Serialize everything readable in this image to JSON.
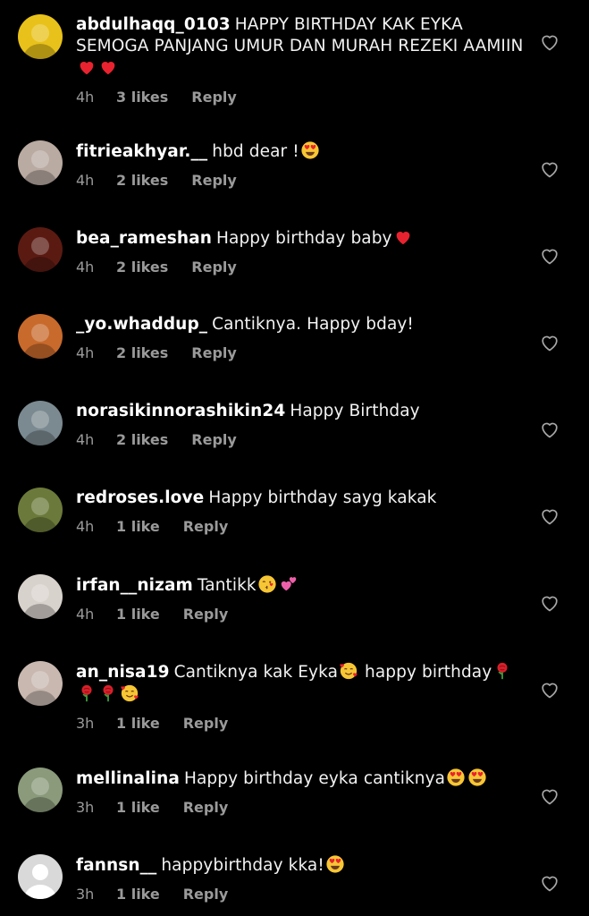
{
  "comments": [
    {
      "username": "abdulhaqq_0103",
      "text": "HAPPY BIRTHDAY KAK EYKA SEMOGA PANJANG UMUR DAN MURAH REZEKI AAMIIN",
      "emojis": [
        "heart-red",
        "heart-red"
      ],
      "time": "4h",
      "likes": "3 likes",
      "reply": "Reply",
      "avatar_color": "#e8c21a"
    },
    {
      "username": "fitrieakhyar.__",
      "text": "hbd dear !",
      "emojis": [
        "heart-eyes"
      ],
      "time": "4h",
      "likes": "2 likes",
      "reply": "Reply",
      "avatar_color": "#b9aaa2"
    },
    {
      "username": "bea_rameshan",
      "text": "Happy birthday baby",
      "emojis": [
        "heart-red"
      ],
      "time": "4h",
      "likes": "2 likes",
      "reply": "Reply",
      "avatar_color": "#5a1a12"
    },
    {
      "username": "_yo.whaddup_",
      "text": "Cantiknya. Happy bday!",
      "emojis": [],
      "time": "4h",
      "likes": "2 likes",
      "reply": "Reply",
      "avatar_color": "#c86a2c"
    },
    {
      "username": "norasikinnorashikin24",
      "text": "Happy Birthday",
      "emojis": [],
      "time": "4h",
      "likes": "2 likes",
      "reply": "Reply",
      "avatar_color": "#7b8a90"
    },
    {
      "username": "redroses.love",
      "text": "Happy birthday sayg kakak",
      "emojis": [],
      "time": "4h",
      "likes": "1 like",
      "reply": "Reply",
      "avatar_color": "#6b7a3a"
    },
    {
      "username": "irfan__nizam",
      "text": "Tantikk",
      "emojis": [
        "kiss-face",
        "two-hearts"
      ],
      "time": "4h",
      "likes": "1 like",
      "reply": "Reply",
      "avatar_color": "#d8d2cc"
    },
    {
      "username": "an_nisa19",
      "text": "Cantiknya kak Eyka",
      "emojis": [
        "smiling-hearts"
      ],
      "text2": "happy birthday",
      "emojis2": [
        "rose",
        "rose",
        "rose",
        "smiling-hearts"
      ],
      "time": "3h",
      "likes": "1 like",
      "reply": "Reply",
      "avatar_color": "#c8b8b0"
    },
    {
      "username": "mellinalina",
      "text": "Happy birthday eyka cantiknya",
      "emojis": [
        "heart-eyes",
        "heart-eyes"
      ],
      "time": "3h",
      "likes": "1 like",
      "reply": "Reply",
      "avatar_color": "#8a9a7a"
    },
    {
      "username": "fannsn__",
      "text": "happybirthday kka!",
      "emojis": [
        "heart-eyes"
      ],
      "time": "3h",
      "likes": "1 like",
      "reply": "Reply",
      "avatar_color": "#d9d9d9"
    }
  ]
}
